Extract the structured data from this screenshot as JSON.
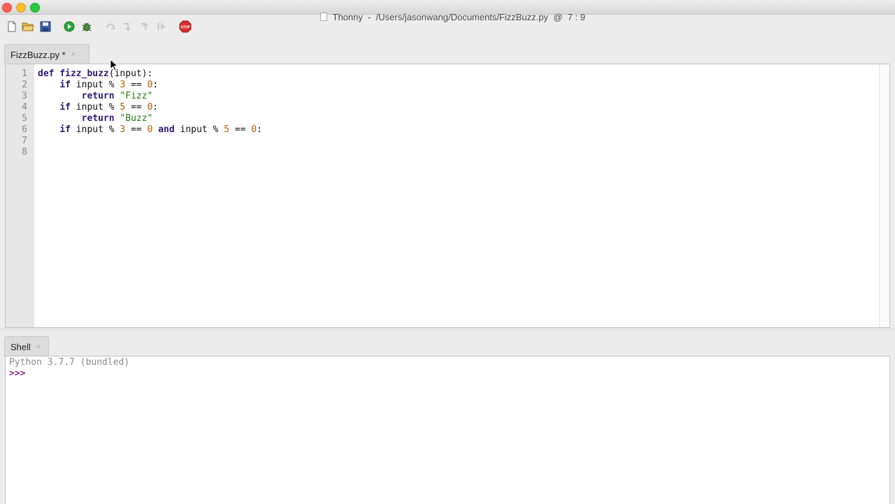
{
  "window": {
    "title": "Thonny  -  /Users/jasonwang/Documents/FizzBuzz.py  @  7 : 9"
  },
  "toolbar": {
    "buttons": [
      "new-file-icon",
      "open-folder-icon",
      "save-icon",
      "run-icon",
      "debug-icon",
      "step-over-icon",
      "step-into-icon",
      "step-out-icon",
      "resume-icon",
      "stop-icon"
    ],
    "stop_label": "STOP"
  },
  "editor": {
    "tab_label": "FizzBuzz.py *",
    "close_glyph": "×",
    "line_numbers": [
      "1",
      "2",
      "3",
      "4",
      "5",
      "6",
      "7",
      "8"
    ],
    "lines": [
      [
        {
          "t": "def",
          "c": "kw"
        },
        {
          "t": " "
        },
        {
          "t": "fizz_buzz",
          "c": "fn"
        },
        {
          "t": "(input):"
        }
      ],
      [
        {
          "t": "    "
        },
        {
          "t": "if",
          "c": "kw"
        },
        {
          "t": " input % "
        },
        {
          "t": "3",
          "c": "num"
        },
        {
          "t": " == "
        },
        {
          "t": "0",
          "c": "num"
        },
        {
          "t": ":"
        }
      ],
      [
        {
          "t": "        "
        },
        {
          "t": "return",
          "c": "kw"
        },
        {
          "t": " "
        },
        {
          "t": "\"Fizz\"",
          "c": "str"
        }
      ],
      [
        {
          "t": "    "
        },
        {
          "t": "if",
          "c": "kw"
        },
        {
          "t": " input % "
        },
        {
          "t": "5",
          "c": "num"
        },
        {
          "t": " == "
        },
        {
          "t": "0",
          "c": "num"
        },
        {
          "t": ":"
        }
      ],
      [
        {
          "t": "        "
        },
        {
          "t": "return",
          "c": "kw"
        },
        {
          "t": " "
        },
        {
          "t": "\"Buzz\"",
          "c": "str"
        }
      ],
      [
        {
          "t": "    "
        },
        {
          "t": "if",
          "c": "kw"
        },
        {
          "t": " input % "
        },
        {
          "t": "3",
          "c": "num"
        },
        {
          "t": " == "
        },
        {
          "t": "0",
          "c": "num"
        },
        {
          "t": " "
        },
        {
          "t": "and",
          "c": "kw"
        },
        {
          "t": " input % "
        },
        {
          "t": "5",
          "c": "num"
        },
        {
          "t": " == "
        },
        {
          "t": "0",
          "c": "num"
        },
        {
          "t": ":"
        }
      ],
      [],
      []
    ]
  },
  "shell": {
    "tab_label": "Shell",
    "close_glyph": "×",
    "banner": "Python 3.7.7 (bundled)",
    "prompt": ">>>"
  }
}
